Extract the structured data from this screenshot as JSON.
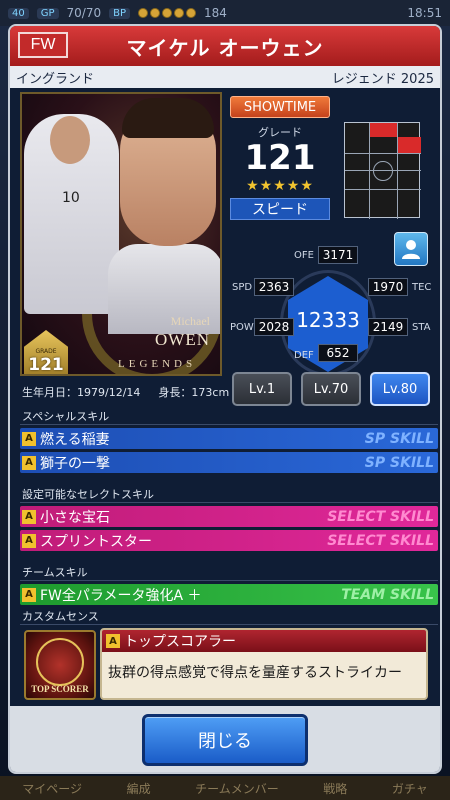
{
  "status": {
    "level": "40",
    "gp_label": "GP",
    "stamina": "70/70",
    "bp_label": "BP",
    "gems": "184",
    "clock": "18:51"
  },
  "player": {
    "position": "FW",
    "name": "マイケル オーウェン",
    "nation": "イングランド",
    "edition": "レジェンド 2025",
    "card_sig_first": "Michael",
    "card_sig_last": "OWEN",
    "card_series": "LEGENDS",
    "card_grade_small": "GRADE",
    "card_grade": "121",
    "birth": "生年月日：1979/12/14",
    "height": "身長：173cm"
  },
  "summary": {
    "showtime": "SHOWTIME",
    "grade_label": "グレード",
    "grade": "121",
    "stars": "★★★★★",
    "type": "スピード"
  },
  "stats": {
    "total": "12333",
    "ofe_label": "OFE",
    "ofe": "3171",
    "spd_label": "SPD",
    "spd": "2363",
    "tec_label": "TEC",
    "tec": "1970",
    "pow_label": "POW",
    "pow": "2028",
    "sta_label": "STA",
    "sta": "2149",
    "def_label": "DEF",
    "def": "652"
  },
  "levels": [
    "Lv.1",
    "Lv.70",
    "Lv.80"
  ],
  "sections": {
    "special": "スペシャルスキル",
    "select": "設定可能なセレクトスキル",
    "team": "チームスキル",
    "sense": "カスタムセンス"
  },
  "skills": {
    "sp": [
      {
        "name": "燃える稲妻",
        "tag": "SP SKILL"
      },
      {
        "name": "獅子の一撃",
        "tag": "SP SKILL"
      }
    ],
    "select": [
      {
        "name": "小さな宝石",
        "tag": "SELECT SKILL"
      },
      {
        "name": "スプリントスター",
        "tag": "SELECT SKILL"
      }
    ],
    "team": [
      {
        "name": "FW全パラメータ強化A ＋",
        "tag": "TEAM SKILL"
      }
    ]
  },
  "sense": {
    "image_label": "TOP SCORER",
    "title": "トップスコアラー",
    "description": "抜群の得点感覚で得点を量産するストライカー"
  },
  "icon_letter": "A",
  "close_label": "閉じる",
  "nav": [
    "マイページ",
    "編成",
    "チームメンバー",
    "戦略",
    "ガチャ"
  ]
}
